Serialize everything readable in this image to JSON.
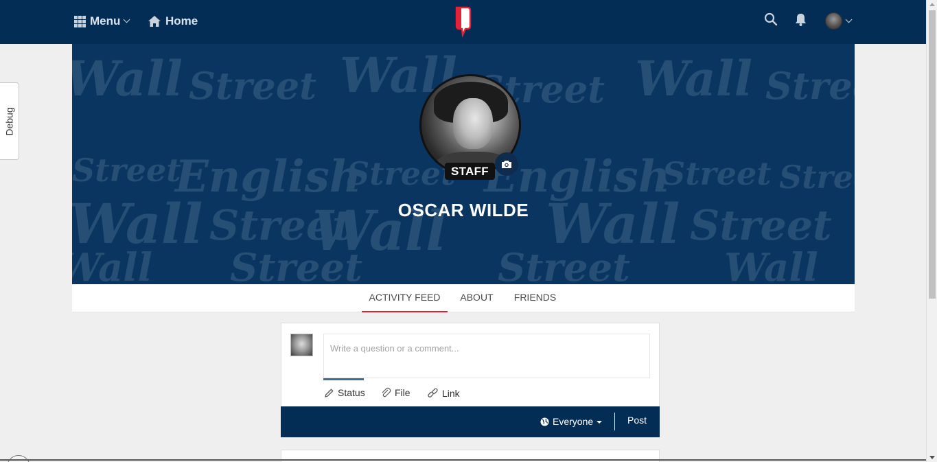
{
  "topbar": {
    "menu_label": "Menu",
    "home_label": "Home",
    "icons": [
      "grid-icon",
      "home-icon",
      "logo-icon",
      "search-icon",
      "bell-icon",
      "avatar"
    ]
  },
  "debug": {
    "label": "Debug"
  },
  "profile": {
    "badge": "STAFF",
    "name": "OSCAR WILDE"
  },
  "tabs": [
    {
      "label": "ACTIVITY FEED",
      "active": true
    },
    {
      "label": "ABOUT",
      "active": false
    },
    {
      "label": "FRIENDS",
      "active": false
    }
  ],
  "composer": {
    "placeholder": "Write a question or a comment...",
    "types": [
      "Status",
      "File",
      "Link"
    ],
    "audience": "Everyone",
    "post_label": "Post"
  },
  "colors": {
    "nav": "#042d56",
    "cover": "#0a3561",
    "accent": "#d41f35",
    "tab_underline": "#3a6d93"
  }
}
